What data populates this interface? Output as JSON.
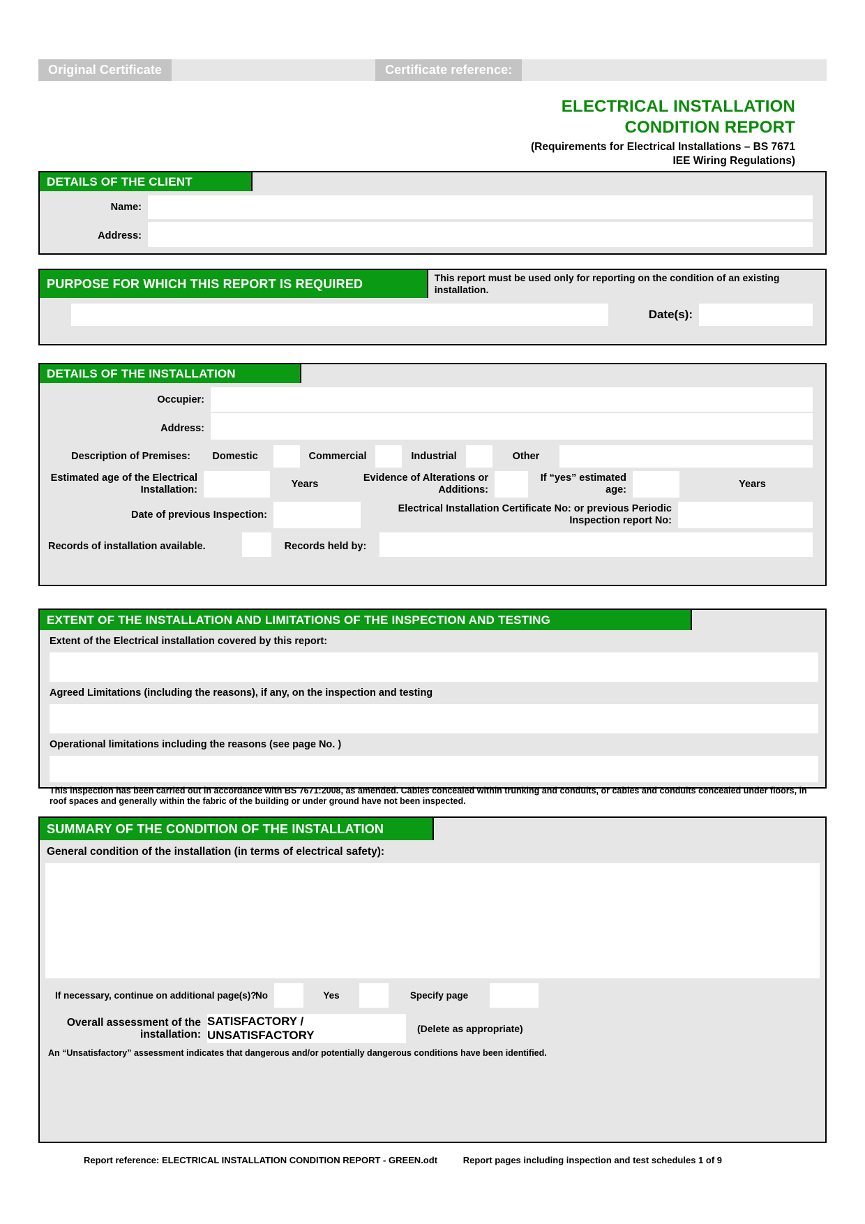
{
  "ribbon": {
    "original_certificate": "Original Certificate",
    "certificate_reference": "Certificate reference:"
  },
  "title": {
    "line1": "ELECTRICAL INSTALLATION",
    "line2": "CONDITION REPORT",
    "sub1": "(Requirements for Electrical Installations – BS 7671",
    "sub2": "IEE Wiring Regulations)"
  },
  "client": {
    "heading": "DETAILS OF THE CLIENT",
    "name_label": "Name:",
    "name_value": "",
    "address_label": "Address:",
    "address_value": ""
  },
  "purpose": {
    "heading": "PURPOSE FOR WHICH THIS REPORT IS REQUIRED",
    "note": "This report must be used only for reporting on the condition of an existing installation.",
    "value": "",
    "dates_label": "Date(s):",
    "dates_value": ""
  },
  "installation": {
    "heading": "DETAILS OF THE INSTALLATION",
    "occupier_label": "Occupier:",
    "occupier_value": "",
    "address_label": "Address:",
    "address_value": "",
    "premises_label": "Description of Premises:",
    "premises_domestic": "Domestic",
    "premises_commercial": "Commercial",
    "premises_industrial": "Industrial",
    "premises_other": "Other",
    "premises_domestic_value": "",
    "premises_commercial_value": "",
    "premises_industrial_value": "",
    "premises_other_value": "",
    "estimated_age_label": "Estimated age of the Electrical Installation:",
    "estimated_age_value": "",
    "years_label": "Years",
    "evidence_label": "Evidence of Alterations or Additions:",
    "evidence_value": "",
    "if_yes_label": "If “yes” estimated age:",
    "if_yes_value": "",
    "if_yes_years_label": "Years",
    "prev_inspection_label": "Date of previous  Inspection:",
    "prev_inspection_value": "",
    "cert_no_label": "Electrical Installation Certificate No: or previous Periodic Inspection report No:",
    "cert_no_value": "",
    "records_available_label": "Records of installation available.",
    "records_available_value": "",
    "records_held_label": "Records held by:",
    "records_held_value": ""
  },
  "extent": {
    "heading": "EXTENT OF THE INSTALLATION AND LIMITATIONS OF THE INSPECTION AND TESTING",
    "extent_label": "Extent of the Electrical installation covered by this report:",
    "extent_value": "",
    "agreed_label": "Agreed Limitations (including the reasons), if any, on the inspection and testing",
    "agreed_value": "",
    "operational_label": "Operational limitations including the reasons (see page No.      )",
    "operational_value": "",
    "disclaimer": "This inspection has been carried out in accordance with BS 7671:2008, as amended. Cables concealed within trunking and conduits, or cables and conduits concealed under floors, in roof spaces and generally within the fabric of the building or under ground have not been inspected."
  },
  "summary": {
    "heading": "SUMMARY OF THE CONDITION OF THE INSTALLATION",
    "general_label": "General condition of the installation (in terms of electrical safety):",
    "general_value": "",
    "continue_label": "If necessary, continue on additional page(s)?",
    "no_label": "No",
    "no_value": "",
    "yes_label": "Yes",
    "yes_value": "",
    "specify_page_label": "Specify page",
    "specify_page_value": "",
    "overall_label": "Overall assessment of the installation:",
    "overall_value": "SATISFACTORY / UNSATISFACTORY",
    "delete_note": "(Delete as appropriate)",
    "unsat_note": "An “Unsatisfactory” assessment indicates that dangerous and/or potentially dangerous conditions have been identified."
  },
  "footer": {
    "left": "Report reference: ELECTRICAL INSTALLATION CONDITION REPORT - GREEN.odt",
    "right": "Report pages including inspection and test schedules 1 of 9"
  },
  "colors": {
    "green": "#0a9a14",
    "title_green": "#0a8a0a",
    "field_grey": "#e6e6e6",
    "tab_grey": "#c4c4c4"
  }
}
